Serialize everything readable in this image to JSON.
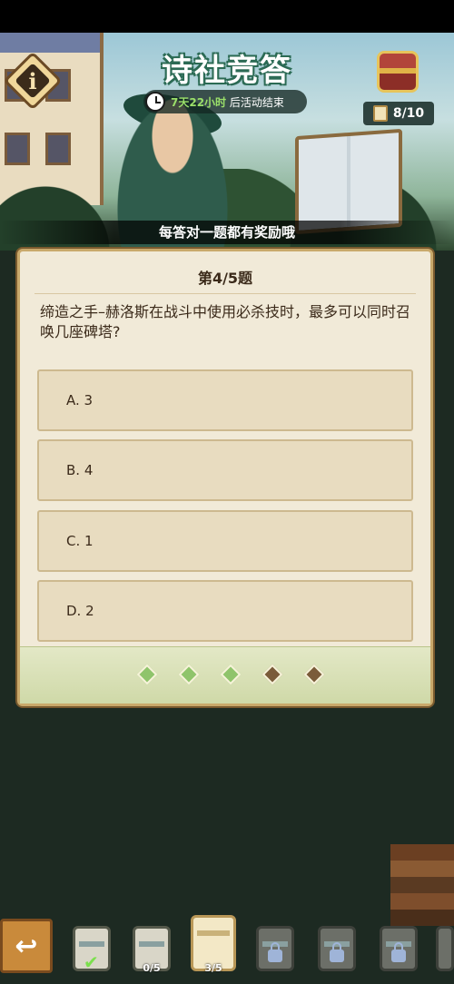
{
  "header": {
    "title": "诗社竞答",
    "timer_prefix": "7天22小时",
    "timer_suffix": " 后活动结束",
    "chest_count": "8/10",
    "caption": "每答对一题都有奖励哦"
  },
  "quiz": {
    "index_label": "第4/5题",
    "question": "缔造之手–赫洛斯在战斗中使用必杀技时，最多可以同时召唤几座碑塔?",
    "options": [
      {
        "label": "A. 3"
      },
      {
        "label": "B. 4"
      },
      {
        "label": "C. 1"
      },
      {
        "label": "D. 2"
      }
    ],
    "progress": {
      "answered": 3,
      "total": 5
    }
  },
  "bottom_nav": {
    "stages": [
      {
        "state": "completed",
        "label": ""
      },
      {
        "state": "partial",
        "label": "0/5"
      },
      {
        "state": "current",
        "label": "3/5"
      },
      {
        "state": "locked",
        "label": ""
      },
      {
        "state": "locked",
        "label": ""
      },
      {
        "state": "locked",
        "label": ""
      },
      {
        "state": "locked",
        "label": ""
      }
    ]
  },
  "colors": {
    "card_bg": "#f1ead8",
    "option_bg": "#e8dcc0",
    "progress_done": "#8fc46b",
    "progress_todo": "#7a5b3a"
  }
}
